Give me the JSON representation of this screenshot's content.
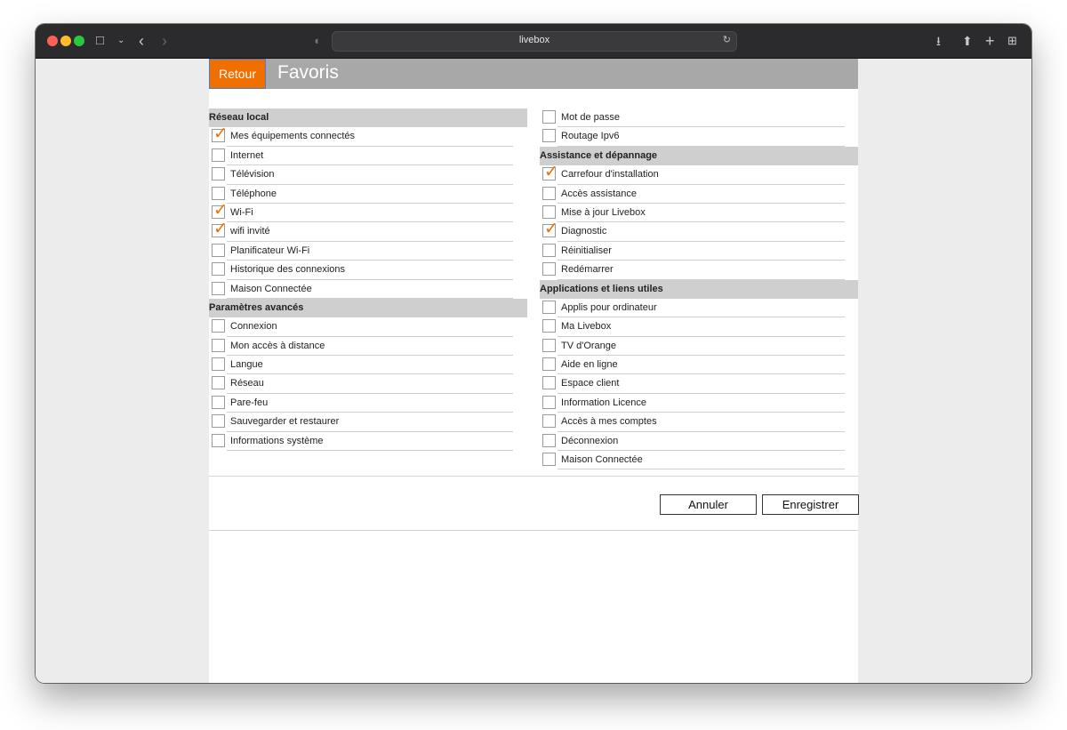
{
  "browser": {
    "url": "livebox"
  },
  "header": {
    "back_label": "Retour",
    "title": "Favoris"
  },
  "left_column": [
    {
      "type": "section",
      "label": "Réseau local"
    },
    {
      "type": "item",
      "label": "Mes équipements connectés",
      "checked": true
    },
    {
      "type": "item",
      "label": "Internet",
      "checked": false
    },
    {
      "type": "item",
      "label": "Télévision",
      "checked": false
    },
    {
      "type": "item",
      "label": "Téléphone",
      "checked": false
    },
    {
      "type": "item",
      "label": "Wi-Fi",
      "checked": true
    },
    {
      "type": "item",
      "label": "wifi invité",
      "checked": true
    },
    {
      "type": "item",
      "label": "Planificateur Wi-Fi",
      "checked": false
    },
    {
      "type": "item",
      "label": "Historique des connexions",
      "checked": false
    },
    {
      "type": "item",
      "label": "Maison Connectée",
      "checked": false
    },
    {
      "type": "section",
      "label": "Paramètres avancés"
    },
    {
      "type": "item",
      "label": "Connexion",
      "checked": false
    },
    {
      "type": "item",
      "label": "Mon accès à distance",
      "checked": false
    },
    {
      "type": "item",
      "label": "Langue",
      "checked": false
    },
    {
      "type": "item",
      "label": "Réseau",
      "checked": false
    },
    {
      "type": "item",
      "label": "Pare-feu",
      "checked": false
    },
    {
      "type": "item",
      "label": "Sauvegarder et restaurer",
      "checked": false
    },
    {
      "type": "item",
      "label": "Informations système",
      "checked": false
    }
  ],
  "right_column": [
    {
      "type": "item",
      "label": "Mot de passe",
      "checked": false
    },
    {
      "type": "item",
      "label": "Routage Ipv6",
      "checked": false
    },
    {
      "type": "section",
      "label": "Assistance et dépannage"
    },
    {
      "type": "item",
      "label": "Carrefour d'installation",
      "checked": true
    },
    {
      "type": "item",
      "label": "Accès assistance",
      "checked": false
    },
    {
      "type": "item",
      "label": "Mise à jour Livebox",
      "checked": false
    },
    {
      "type": "item",
      "label": "Diagnostic",
      "checked": true
    },
    {
      "type": "item",
      "label": "Réinitialiser",
      "checked": false
    },
    {
      "type": "item",
      "label": "Redémarrer",
      "checked": false
    },
    {
      "type": "section",
      "label": "Applications et liens utiles"
    },
    {
      "type": "item",
      "label": "Applis pour ordinateur",
      "checked": false
    },
    {
      "type": "item",
      "label": "Ma Livebox",
      "checked": false
    },
    {
      "type": "item",
      "label": "TV d'Orange",
      "checked": false
    },
    {
      "type": "item",
      "label": "Aide en ligne",
      "checked": false
    },
    {
      "type": "item",
      "label": "Espace client",
      "checked": false
    },
    {
      "type": "item",
      "label": "Information Licence",
      "checked": false
    },
    {
      "type": "item",
      "label": "Accès à mes comptes",
      "checked": false
    },
    {
      "type": "item",
      "label": "Déconnexion",
      "checked": false
    },
    {
      "type": "item",
      "label": "Maison Connectée",
      "checked": false
    }
  ],
  "actions": {
    "cancel_label": "Annuler",
    "save_label": "Enregistrer"
  },
  "colors": {
    "accent": "#f16e00",
    "header_bg": "#a8a8a8",
    "section_bg": "#cfcfcf"
  }
}
